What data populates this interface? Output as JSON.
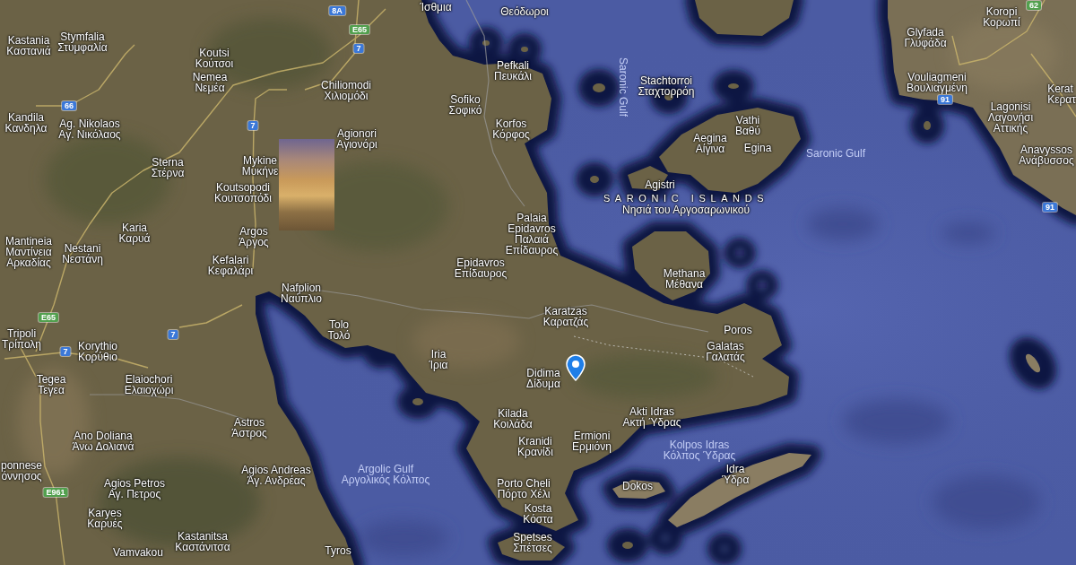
{
  "map": {
    "labels": [
      {
        "kind": "town",
        "lines": [
          "Ίσθμια"
        ]
      },
      {
        "kind": "town",
        "lines": [
          "Θεόδωροι"
        ]
      },
      {
        "kind": "town",
        "lines": [
          "Koropi",
          "Κορωπί"
        ]
      },
      {
        "kind": "town",
        "lines": [
          "Kastania",
          "Καστανιά"
        ]
      },
      {
        "kind": "town",
        "lines": [
          "Stymfalia",
          "Στυμφαλία"
        ]
      },
      {
        "kind": "town",
        "lines": [
          "Glyfada",
          "Γλυφάδα"
        ]
      },
      {
        "kind": "town",
        "lines": [
          "Koutsi",
          "Κούτσοι"
        ]
      },
      {
        "kind": "town",
        "lines": [
          "Pefkali",
          "Πευκάλι"
        ]
      },
      {
        "kind": "town",
        "lines": [
          "Nemea",
          "Νεμέα"
        ]
      },
      {
        "kind": "town",
        "lines": [
          "Chiliomodi",
          "Χιλιομόδι"
        ]
      },
      {
        "kind": "town",
        "lines": [
          "Sofiko",
          "Σοφικό"
        ]
      },
      {
        "kind": "water",
        "lines": [
          "Saronic Gulf"
        ]
      },
      {
        "kind": "town",
        "lines": [
          "Stachtorroi",
          "Σταχτορρόη"
        ]
      },
      {
        "kind": "town",
        "lines": [
          "Vouliagmeni",
          "Βουλιαγμένη"
        ]
      },
      {
        "kind": "town",
        "lines": [
          "Kerat",
          "Κερατ"
        ]
      },
      {
        "kind": "town",
        "lines": [
          "Kandila",
          "Κανδηλα"
        ]
      },
      {
        "kind": "town",
        "lines": [
          "Ag. Nikolaos",
          "Αγ. Νικόλαος"
        ]
      },
      {
        "kind": "town",
        "lines": [
          "Sterna",
          "Στέρνα"
        ]
      },
      {
        "kind": "town",
        "lines": [
          "Mykine",
          "Μυκήνε"
        ]
      },
      {
        "kind": "town",
        "lines": [
          "Agionori",
          "Αγιονόρι"
        ]
      },
      {
        "kind": "town",
        "lines": [
          "Korfos",
          "Κόρφος"
        ]
      },
      {
        "kind": "town",
        "lines": [
          "Aegina",
          "Αίγινα"
        ]
      },
      {
        "kind": "town",
        "lines": [
          "Vathi",
          "Βαθύ"
        ]
      },
      {
        "kind": "town",
        "lines": [
          "Egina"
        ]
      },
      {
        "kind": "water",
        "lines": [
          "Saronic Gulf"
        ]
      },
      {
        "kind": "town",
        "lines": [
          "Lagonisi",
          "Λαγονήσι",
          "Αττικής"
        ]
      },
      {
        "kind": "town",
        "lines": [
          "Anavyssos",
          "Ανάβυσσος"
        ]
      },
      {
        "kind": "town",
        "lines": [
          "Koutsopodi",
          "Κουτσοπόδι"
        ]
      },
      {
        "kind": "town",
        "lines": [
          "Agistri"
        ]
      },
      {
        "kind": "region",
        "lines": [
          "SARONIC ISLANDS",
          "Νησιά του Αργοσαρωνικού"
        ]
      },
      {
        "kind": "town",
        "lines": [
          "Mantineia",
          "Μαντίνεια",
          "Αρκαδίας"
        ]
      },
      {
        "kind": "town",
        "lines": [
          "Nestani",
          "Νεστάνη"
        ]
      },
      {
        "kind": "town",
        "lines": [
          "Karia",
          "Καρυά"
        ]
      },
      {
        "kind": "town",
        "lines": [
          "Kefalari",
          "Κεφαλάρι"
        ]
      },
      {
        "kind": "town",
        "lines": [
          "Argos",
          "Άργος"
        ]
      },
      {
        "kind": "town",
        "lines": [
          "Epidavros",
          "Επίδαυρος"
        ]
      },
      {
        "kind": "town",
        "lines": [
          "Palaia",
          "Epidavros",
          "Παλαιά",
          "Επίδαυρος"
        ]
      },
      {
        "kind": "town",
        "lines": [
          "Nafplion",
          "Ναύπλιο"
        ]
      },
      {
        "kind": "town",
        "lines": [
          "Methana",
          "Μέθανα"
        ]
      },
      {
        "kind": "town",
        "lines": [
          "Tripoli",
          "Τρίπολη"
        ]
      },
      {
        "kind": "town",
        "lines": [
          "Tolo",
          "Τολό"
        ]
      },
      {
        "kind": "town",
        "lines": [
          "Karatzas",
          "Καρατζάς"
        ]
      },
      {
        "kind": "town",
        "lines": [
          "Poros"
        ]
      },
      {
        "kind": "town",
        "lines": [
          "Korythio",
          "Κορύθιο"
        ]
      },
      {
        "kind": "town",
        "lines": [
          "Iria",
          "Ίρια"
        ]
      },
      {
        "kind": "town",
        "lines": [
          "Galatas",
          "Γαλατάς"
        ]
      },
      {
        "kind": "town",
        "lines": [
          "Tegea",
          "Τεγεα"
        ]
      },
      {
        "kind": "town",
        "lines": [
          "Elaiochori",
          "Ελαιοχώρι"
        ]
      },
      {
        "kind": "town",
        "lines": [
          "Didima",
          "Δίδυμα"
        ]
      },
      {
        "kind": "town",
        "lines": [
          "Ano Doliana",
          "Άνω Δολιανά"
        ]
      },
      {
        "kind": "town",
        "lines": [
          "Astros",
          "Άστρος"
        ]
      },
      {
        "kind": "town",
        "lines": [
          "Kilada",
          "Κοιλάδα"
        ]
      },
      {
        "kind": "town",
        "lines": [
          "Kranidi",
          "Κρανίδι"
        ]
      },
      {
        "kind": "town",
        "lines": [
          "Ermioni",
          "Ερμιόνη"
        ]
      },
      {
        "kind": "town",
        "lines": [
          "Akti Idras",
          "Ακτή Ύδρας"
        ]
      },
      {
        "kind": "water",
        "lines": [
          "Kolpos Idras",
          "Κόλπος Ύδρας"
        ]
      },
      {
        "kind": "town",
        "lines": [
          "ponnese",
          "όννησος"
        ]
      },
      {
        "kind": "town",
        "lines": [
          "Agios Petros",
          "Αγ. Πετρος"
        ]
      },
      {
        "kind": "town",
        "lines": [
          "Agios Andreas",
          "Άγ. Ανδρέας"
        ]
      },
      {
        "kind": "water",
        "lines": [
          "Argolic Gulf",
          "Αργολικός Κόλπος"
        ]
      },
      {
        "kind": "town",
        "lines": [
          "Porto Cheli",
          "Πόρτο Χέλι"
        ]
      },
      {
        "kind": "town",
        "lines": [
          "Dokos"
        ]
      },
      {
        "kind": "town",
        "lines": [
          "Idra",
          "Ύδρα"
        ]
      },
      {
        "kind": "town",
        "lines": [
          "Karyes",
          "Καρυές"
        ]
      },
      {
        "kind": "town",
        "lines": [
          "Kosta",
          "Κόστα"
        ]
      },
      {
        "kind": "town",
        "lines": [
          "Vamvakou"
        ]
      },
      {
        "kind": "town",
        "lines": [
          "Kastanitsa",
          "Καστάνιτσα"
        ]
      },
      {
        "kind": "town",
        "lines": [
          "Tyros"
        ]
      },
      {
        "kind": "town",
        "lines": [
          "Spetses",
          "Σπέτσες"
        ]
      }
    ],
    "road_shields": [
      {
        "text": "62",
        "color": "#52a04e"
      },
      {
        "text": "8A",
        "color": "#3b78d8"
      },
      {
        "text": "E65",
        "color": "#52a04e"
      },
      {
        "text": "7",
        "color": "#3b78d8"
      },
      {
        "text": "91",
        "color": "#3b78d8"
      },
      {
        "text": "66",
        "color": "#3b78d8"
      },
      {
        "text": "7",
        "color": "#3b78d8"
      },
      {
        "text": "91",
        "color": "#3b78d8"
      },
      {
        "text": "E65",
        "color": "#52a04e"
      },
      {
        "text": "7",
        "color": "#3b78d8"
      },
      {
        "text": "7",
        "color": "#3b78d8"
      },
      {
        "text": "E961",
        "color": "#52a04e"
      }
    ]
  }
}
